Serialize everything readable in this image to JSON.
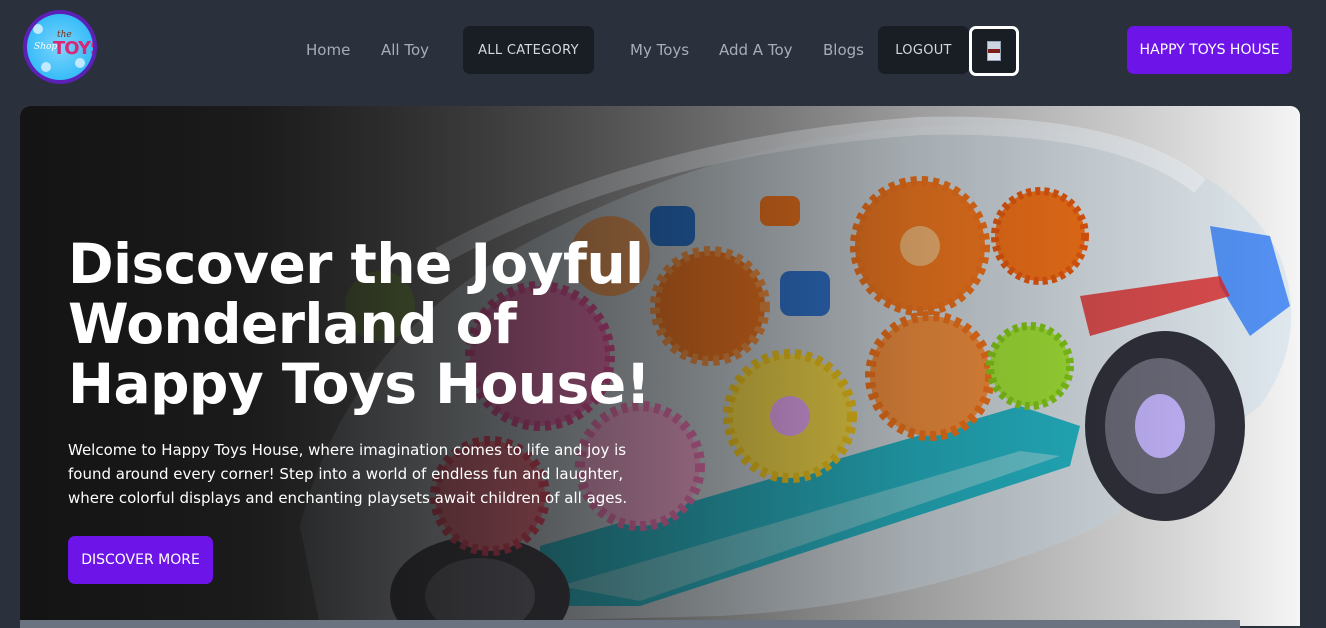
{
  "brand": {
    "logo_icon": "shop-toys-logo",
    "logo_text_the": "the",
    "logo_text_shop": "Shop",
    "logo_text_toys": "TOYS"
  },
  "nav": {
    "links": [
      "Home",
      "All Toy",
      "My Toys",
      "Add A Toy",
      "Blogs"
    ],
    "all_category_label": "ALL CATEGORY",
    "logout_label": "LOGOUT",
    "avatar_icon": "user-avatar",
    "cta_label": "HAPPY TOYS HOUSE"
  },
  "hero": {
    "image": "transparent-gear-toy-car",
    "title": "Discover the Joyful Wonderland of Happy Toys House!",
    "description": "Welcome to Happy Toys House, where imagination comes to life and joy is found around every corner! Step into a world of endless fun and laughter, where colorful displays and enchanting playsets await children of all ages.",
    "button_label": "DISCOVER MORE"
  },
  "colors": {
    "background": "#2a303c",
    "accent": "#6d15e8",
    "dark_button": "#191e24",
    "nav_text": "#a6adbb"
  }
}
